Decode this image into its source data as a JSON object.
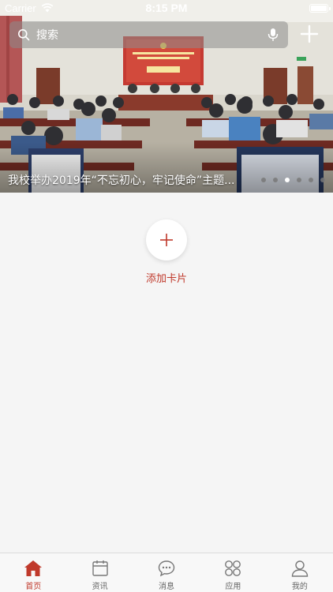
{
  "status_bar": {
    "carrier": "Carrier",
    "time": "8:15 PM"
  },
  "search": {
    "placeholder": "搜索"
  },
  "banner": {
    "caption": "我校举办2019年“不忘初心，牢记使命”主题...",
    "dots_count": 6,
    "active_dot": 3
  },
  "add_card": {
    "label": "添加卡片"
  },
  "tabs": [
    {
      "label": "首页",
      "icon": "home-icon",
      "active": true
    },
    {
      "label": "资讯",
      "icon": "calendar-icon",
      "active": false
    },
    {
      "label": "消息",
      "icon": "chat-bubble-icon",
      "active": false
    },
    {
      "label": "应用",
      "icon": "apps-grid-icon",
      "active": false
    },
    {
      "label": "我的",
      "icon": "person-icon",
      "active": false
    }
  ],
  "colors": {
    "accent": "#c0392b",
    "inactive": "#777777"
  }
}
